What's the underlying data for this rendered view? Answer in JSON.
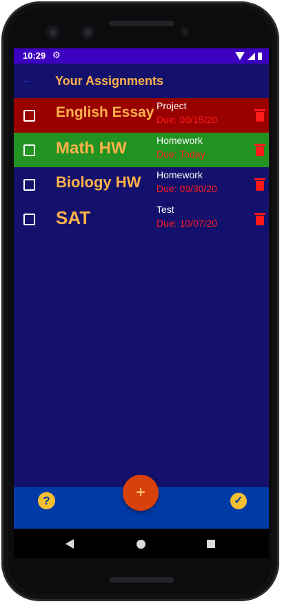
{
  "status": {
    "time": "10:29",
    "settings_icon": "gear-icon"
  },
  "appbar": {
    "back_icon": "arrow-back-icon",
    "title": "Your Assignments"
  },
  "assignments": [
    {
      "name": "English Essay",
      "type": "Project",
      "due": "Due: 09/15/20",
      "color": "#990000"
    },
    {
      "name": "Math HW",
      "type": "Homework",
      "due": "Due: Today",
      "color": "#229222"
    },
    {
      "name": "Biology HW",
      "type": "Homework",
      "due": "Due: 09/30/20",
      "color": "#13116b"
    },
    {
      "name": "SAT",
      "type": "Test",
      "due": "Due: 10/07/20",
      "color": "#13116b"
    }
  ],
  "bottom": {
    "help_label": "?",
    "add_label": "+",
    "done_label": "✓"
  },
  "colors": {
    "accent": "#ffb14a",
    "due": "#ff1a1a",
    "background": "#13116b",
    "bottom_bar": "#003aa6",
    "fab": "#d9410c",
    "status_bar": "#3d00c0"
  }
}
